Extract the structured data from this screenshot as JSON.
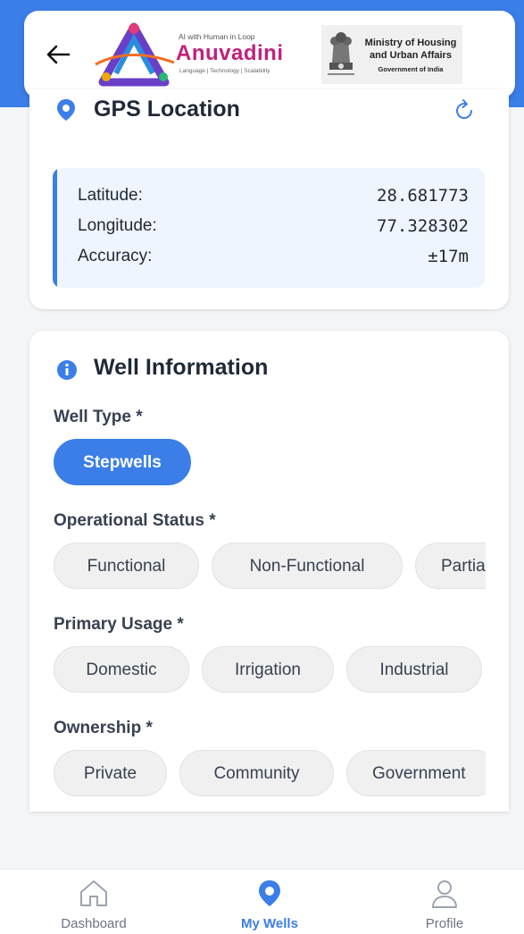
{
  "header": {
    "back_icon": "arrow-left-icon",
    "logo": {
      "tagline": "AI with Human in Loop",
      "name": "Anuvadini",
      "subtitle": "Language | Technology | Scalability"
    },
    "ministry": {
      "line1": "Ministry of Housing",
      "line2": "and Urban Affairs",
      "line3": "Government of India"
    }
  },
  "gps": {
    "title": "GPS Location",
    "icon": "location-pin-icon",
    "refresh_icon": "refresh-icon",
    "rows": [
      {
        "label": "Latitude:",
        "value": "28.681773"
      },
      {
        "label": "Longitude:",
        "value": "77.328302"
      },
      {
        "label": "Accuracy:",
        "value": "±17m"
      }
    ]
  },
  "well_info": {
    "title": "Well Information",
    "icon": "info-icon",
    "sections": [
      {
        "label": "Well Type *",
        "chips": [
          "Stepwells"
        ],
        "selected": "Stepwells"
      },
      {
        "label": "Operational Status *",
        "chips": [
          "Functional",
          "Non-Functional",
          "Partia"
        ]
      },
      {
        "label": "Primary Usage *",
        "chips": [
          "Domestic",
          "Irrigation",
          "Industrial"
        ]
      },
      {
        "label": "Ownership *",
        "chips": [
          "Private",
          "Community",
          "Government"
        ]
      }
    ]
  },
  "nav": {
    "items": [
      {
        "label": "Dashboard",
        "icon": "home-icon",
        "active": false
      },
      {
        "label": "My Wells",
        "icon": "location-pin-icon",
        "active": true
      },
      {
        "label": "Profile",
        "icon": "person-icon",
        "active": false
      }
    ]
  },
  "colors": {
    "accent": "#3b7ee8",
    "brand": "#c2207a"
  }
}
